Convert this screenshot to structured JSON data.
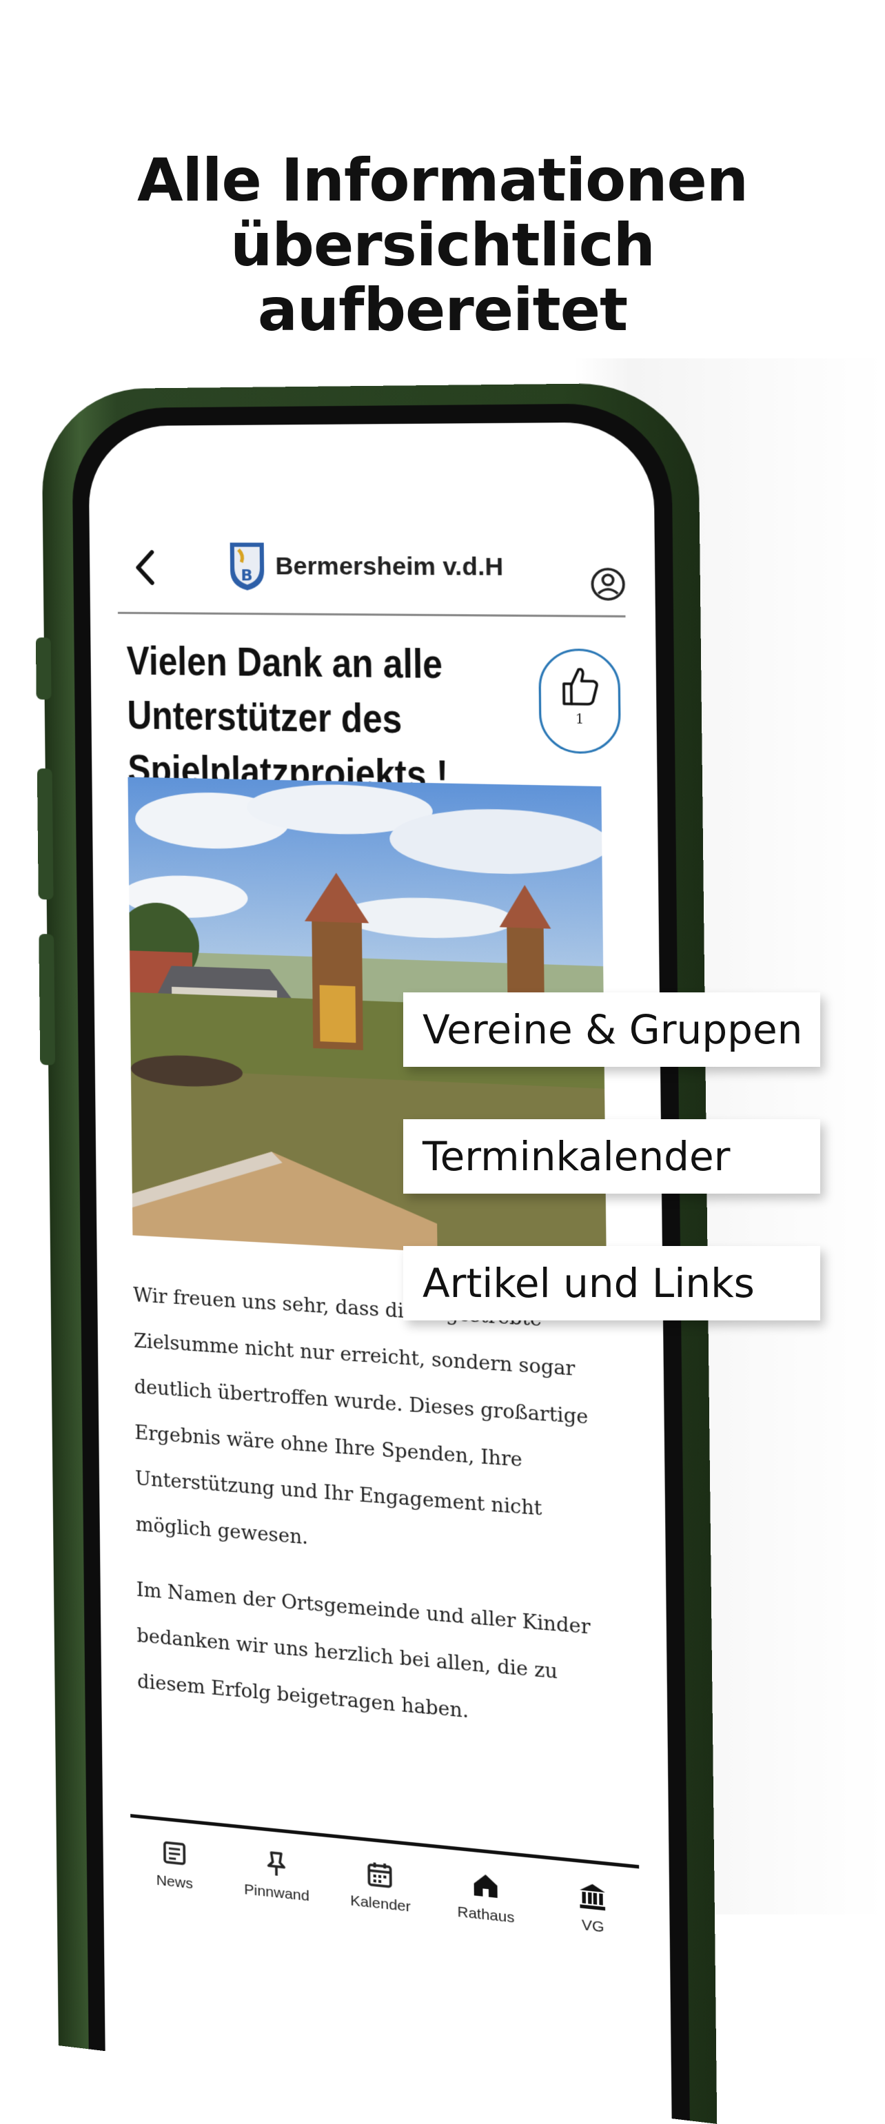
{
  "headline": {
    "line1": "Alle Informationen",
    "line2": "übersichtlich",
    "line3": "aufbereitet"
  },
  "app": {
    "town_name": "Bermersheim v.d.H",
    "back_icon": "chevron-left-icon",
    "profile_icon": "user-circle-icon"
  },
  "article": {
    "title_line1": "Vielen Dank an alle",
    "title_line2": "Unterstützer des",
    "title_line3": "Spielplatzprojekts !",
    "like_count": "1",
    "body_p1": "Wir freuen uns sehr, dass die angestrebte Zielsumme nicht nur erreicht, sondern sogar deutlich übertroffen wurde. Dieses großartige Ergebnis wäre ohne Ihre Spenden, Ihre Unterstützung und Ihr Engagement nicht möglich gewesen.",
    "body_p2": "Im Namen der Ortsgemeinde und aller Kinder bedanken wir uns herzlich bei allen, die zu diesem Erfolg beigetragen haben."
  },
  "tabs": [
    {
      "label": "News",
      "icon": "newspaper-icon"
    },
    {
      "label": "Pinnwand",
      "icon": "pin-icon"
    },
    {
      "label": "Kalender",
      "icon": "calendar-icon"
    },
    {
      "label": "Rathaus",
      "icon": "house-icon"
    },
    {
      "label": "VG",
      "icon": "building-icon"
    }
  ],
  "callouts": {
    "c1": "Vereine & Gruppen",
    "c2": "Terminkalender",
    "c3": "Artikel und Links"
  },
  "colors": {
    "phone_frame": "#2b4424",
    "like_border": "#2b78b6",
    "crest_blue": "#2d5fa8"
  }
}
